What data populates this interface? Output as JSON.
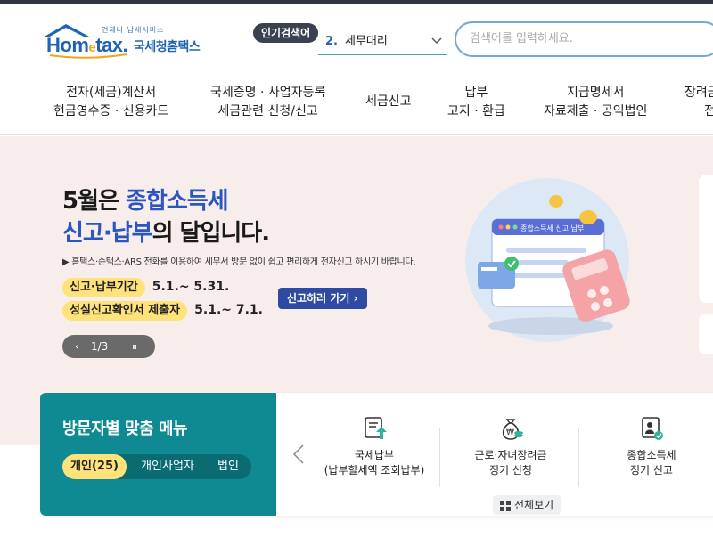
{
  "logo": {
    "small_text": "언제나 납세서비스",
    "brand_pre": "Hom",
    "brand_e": "e",
    "brand_post": "tax.",
    "name": "국세청홈택스"
  },
  "search": {
    "popular_label": "인기검색어",
    "popular_rank": "2.",
    "popular_keyword": "세무대리",
    "placeholder": "검색어를 입력하세요."
  },
  "nav": {
    "items": [
      {
        "line1": "전자(세금)계산서",
        "line2": "현금영수증 · 신용카드"
      },
      {
        "line1": "국세증명 · 사업자등록",
        "line2": "세금관련 신청/신고"
      },
      {
        "line1": "세금신고",
        "line2": ""
      },
      {
        "line1": "납부",
        "line2": "고지 · 환급"
      },
      {
        "line1": "지급명세서",
        "line2": "자료제출 · 공익법인"
      },
      {
        "line1": "장려금",
        "line2": "전"
      }
    ]
  },
  "banner": {
    "headline_l1_a": "5월은 ",
    "headline_l1_b": "종합소득세",
    "headline_l2_a": "신고·납부",
    "headline_l2_b": "의 달입니다.",
    "notice": "▶ 홈택스·손택스·ARS 전화를 이용하여 세무서 방문 없이 쉽고 편리하게 전자신고 하시기 바랍니다.",
    "period1_label": "신고·납부기간",
    "period1_date": "5.1.~ 5.31.",
    "period2_label": "성실신고확인서 제출자",
    "period2_date": "5.1.~ 7.1.",
    "go_button": "신고하러 가기 ›",
    "pager_text": "1/3",
    "illus_caption": "종합소득세 신고·납부"
  },
  "visitor": {
    "title": "방문자별 맞춤 메뉴",
    "tabs": [
      "개인(25)",
      "개인사업자",
      "법인"
    ],
    "services": [
      {
        "line1": "국세납부",
        "line2": "(납부할세액 조회납부)"
      },
      {
        "line1": "근로·자녀장려금",
        "line2": "정기 신청"
      },
      {
        "line1": "종합소득세",
        "line2": "정기 신고"
      }
    ],
    "all_view": "전체보기"
  },
  "colors": {
    "brand_blue": "#1f63b6",
    "teal": "#0f8a93",
    "banner_bg": "#f7eeeb",
    "highlight_yellow": "#ffe27a",
    "button_navy": "#2e4aa3"
  }
}
